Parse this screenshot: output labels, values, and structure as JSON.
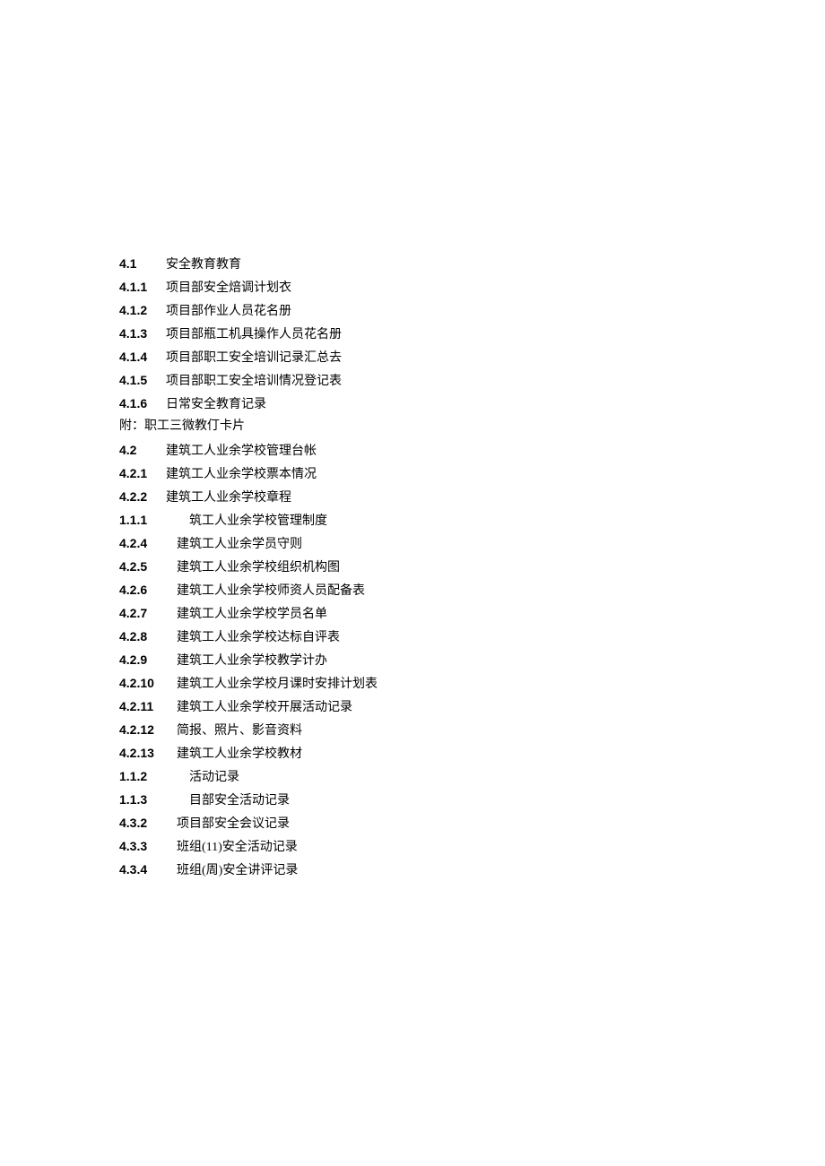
{
  "items": [
    {
      "number": "4.1",
      "text": "安全教育教育",
      "wide": false,
      "indent": false
    },
    {
      "number": "4.1.1",
      "text": "项目部安全焙调计划衣",
      "wide": false,
      "indent": false
    },
    {
      "number": "4.1.2",
      "text": "项目部作业人员花名册",
      "wide": false,
      "indent": false
    },
    {
      "number": "4.1.3",
      "text": "项目部瓶工机具操作人员花名册",
      "wide": false,
      "indent": false
    },
    {
      "number": "4.1.4",
      "text": "项目部职工安全培训记录汇总去",
      "wide": false,
      "indent": false
    },
    {
      "number": "4.1.5",
      "text": "项目部职工安全培训情况登记表",
      "wide": false,
      "indent": false
    },
    {
      "number": "4.1.6",
      "text": "日常安全教育记录",
      "wide": false,
      "indent": false
    },
    {
      "attach": true,
      "text": "附：职工三微教仃卡片"
    },
    {
      "number": "4.2",
      "text": "建筑工人业余学校管理台帐",
      "wide": false,
      "indent": false
    },
    {
      "number": "4.2.1",
      "text": "建筑工人业余学校票本情况",
      "wide": false,
      "indent": false
    },
    {
      "number": "4.2.2",
      "text": "建筑工人业余学校章程",
      "wide": false,
      "indent": false
    },
    {
      "number": "1.1.1",
      "text": "筑工人业余学校管理制度",
      "wide": true,
      "indent": true
    },
    {
      "number": "4.2.4",
      "text": "建筑工人业余学员守则",
      "wide": true,
      "indent": false
    },
    {
      "number": "4.2.5",
      "text": "建筑工人业余学校组织机构图",
      "wide": true,
      "indent": false
    },
    {
      "number": "4.2.6",
      "text": "建筑工人业余学校师资人员配备表",
      "wide": true,
      "indent": false
    },
    {
      "number": "4.2.7",
      "text": "建筑工人业余学校学员名单",
      "wide": true,
      "indent": false
    },
    {
      "number": "4.2.8",
      "text": "建筑工人业余学校达标自评表",
      "wide": true,
      "indent": false
    },
    {
      "number": "4.2.9",
      "text": "建筑工人业余学校教学计办",
      "wide": true,
      "indent": false
    },
    {
      "number": "4.2.10",
      "text": "建筑工人业余学校月课时安排计划表",
      "wide": true,
      "indent": false
    },
    {
      "number": "4.2.11",
      "text": "建筑工人业余学校开展活动记录",
      "wide": true,
      "indent": false
    },
    {
      "number": "4.2.12",
      "text": "简报、照片、影音资料",
      "wide": true,
      "indent": false
    },
    {
      "number": "4.2.13",
      "text": "建筑工人业余学校教材",
      "wide": true,
      "indent": false
    },
    {
      "number": "1.1.2",
      "text": "活动记录",
      "wide": true,
      "indent": true
    },
    {
      "number": "1.1.3",
      "text": "目部安全活动记录",
      "wide": true,
      "indent": true
    },
    {
      "number": "4.3.2",
      "text": "项目部安全会议记录",
      "wide": true,
      "indent": false
    },
    {
      "number": "4.3.3",
      "text": "班组(11)安全活动记录",
      "wide": true,
      "indent": false
    },
    {
      "number": "4.3.4",
      "text": "班组(周)安全讲评记录",
      "wide": true,
      "indent": false
    }
  ]
}
